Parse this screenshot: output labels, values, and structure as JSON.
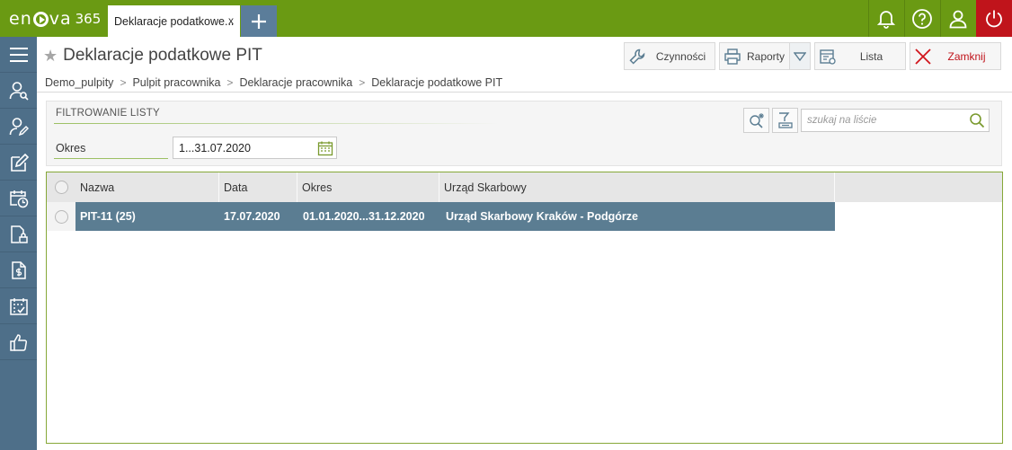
{
  "app": {
    "logo_text": "en",
    "logo_text2": "va",
    "logo_version": "365"
  },
  "tabs": [
    {
      "label": "Deklaracje podatkowe...",
      "close": "x"
    }
  ],
  "colors": {
    "brand_green": "#6a9a13",
    "sidebar": "#4e6f89",
    "selected_row": "#5b7d92",
    "power_red": "#c0141b"
  },
  "top_icons": [
    "bell-icon",
    "help-icon",
    "user-icon",
    "power-icon"
  ],
  "sidebar_icons": [
    "menu-icon",
    "employee-icon",
    "employee-edit-icon",
    "edit-icon",
    "calendar-clock-icon",
    "document-lock-icon",
    "document-money-icon",
    "calendar-check-icon",
    "thumbs-up-icon"
  ],
  "page": {
    "title": "Deklaracje podatkowe PIT"
  },
  "toolbar": {
    "actions": "Czynności",
    "reports": "Raporty",
    "list": "Lista",
    "close": "Zamknij"
  },
  "breadcrumb": [
    "Demo_pulpity",
    "Pulpit pracownika",
    "Deklaracje pracownika",
    "Deklaracje podatkowe PIT"
  ],
  "filter": {
    "title": "FILTROWANIE LISTY",
    "okres_label": "Okres",
    "okres_value": "1...31.07.2020",
    "search_placeholder": "szukaj na liście"
  },
  "grid": {
    "columns": [
      "Nazwa",
      "Data",
      "Okres",
      "Urząd Skarbowy"
    ],
    "rows": [
      {
        "nazwa": "PIT-11 (25)",
        "data": "17.07.2020",
        "okres": "01.01.2020...31.12.2020",
        "urzad": "Urząd Skarbowy Kraków - Podgórze"
      }
    ]
  }
}
